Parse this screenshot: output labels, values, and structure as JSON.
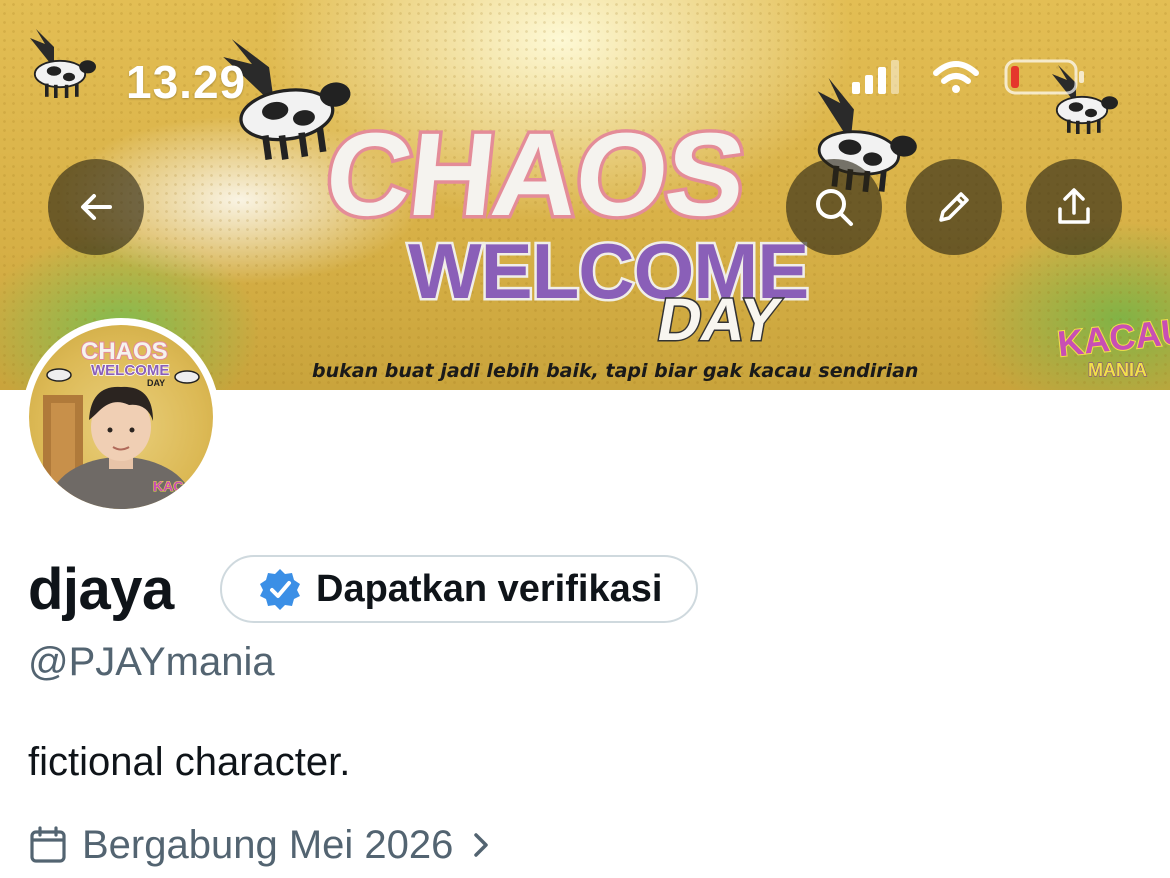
{
  "status_bar": {
    "time": "13.29"
  },
  "banner": {
    "title_word1": "CHAOS",
    "title_word2": "WELCOME",
    "title_word3": "DAY",
    "tagline": "bukan buat jadi lebih baik, tapi biar gak kacau sendirian",
    "logo_line1": "KACAU",
    "logo_line2": "MANIA"
  },
  "header_buttons": {
    "back": "arrow-left-icon",
    "search": "search-icon",
    "edit": "pencil-icon",
    "share": "share-icon"
  },
  "avatar_art": {
    "title_word1": "CHAOS",
    "title_word2": "WELCOME",
    "title_word3": "DAY",
    "logo": "KACAU"
  },
  "profile": {
    "display_name": "djaya",
    "verify_label": "Dapatkan verifikasi",
    "handle": "@PJAYmania",
    "bio": "fictional character.",
    "joined": "Bergabung Mei 2026"
  },
  "colors": {
    "verified_badge": "#3b8fe6",
    "secondary_text": "#536471",
    "primary_text": "#0f1419",
    "battery_low": "#e5372c"
  }
}
